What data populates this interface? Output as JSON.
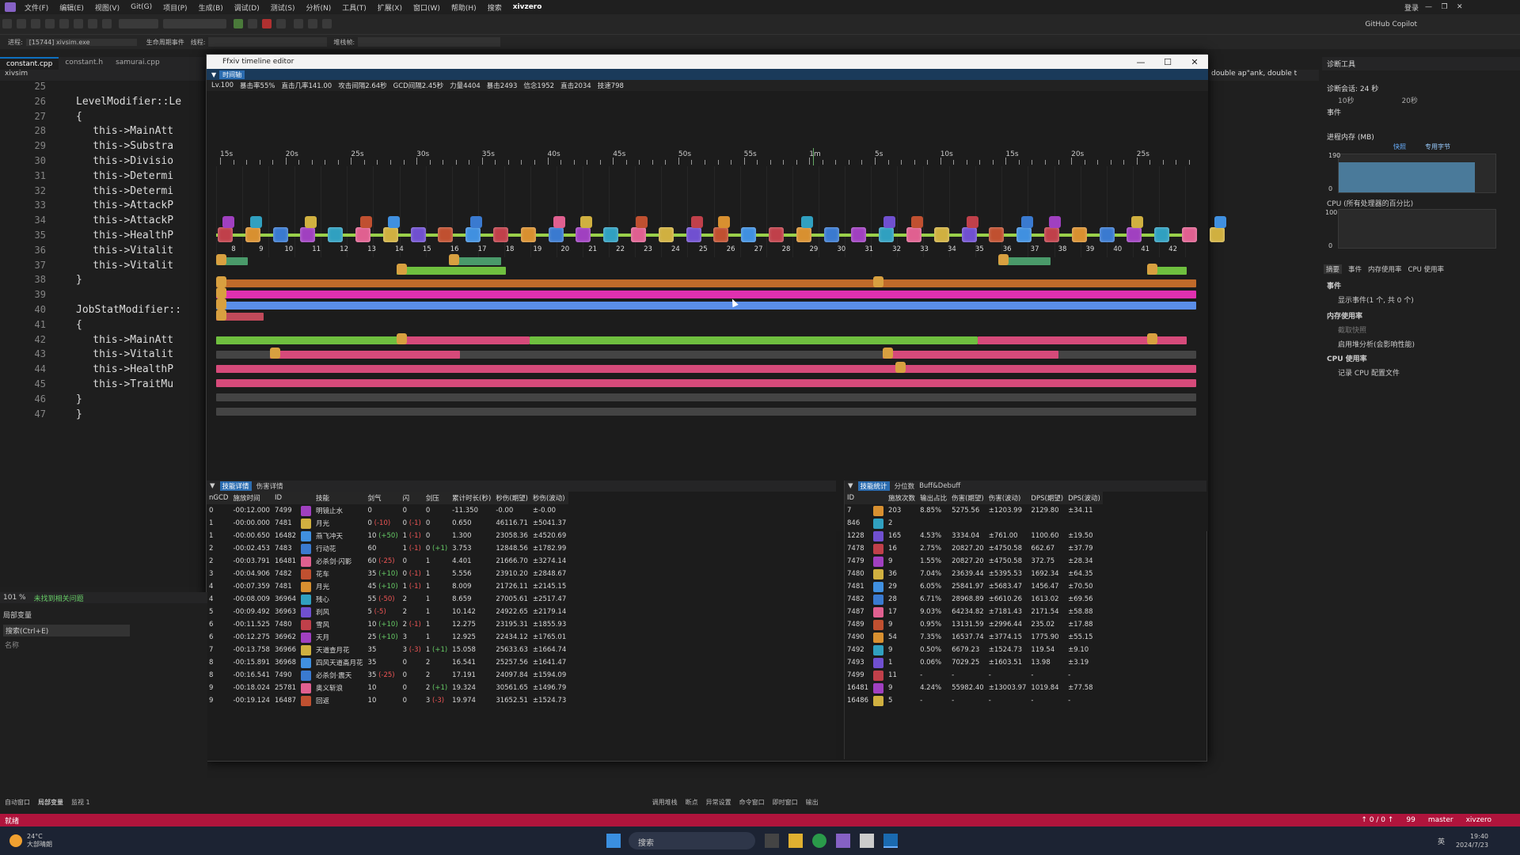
{
  "menu": [
    "文件(F)",
    "编辑(E)",
    "视图(V)",
    "Git(G)",
    "项目(P)",
    "生成(B)",
    "调试(D)",
    "测试(S)",
    "分析(N)",
    "工具(T)",
    "扩展(X)",
    "窗口(W)",
    "帮助(H)",
    "搜索",
    "xivzero"
  ],
  "menu_right": {
    "account": "登录",
    "copilot": "GitHub Copilot"
  },
  "toolbar2": {
    "stack_label": "进程:",
    "stack_value": "[15744] xivsim.exe",
    "lifecycle": "生命周期事件",
    "thread": "线程:",
    "frame": "堆栈帧:"
  },
  "editor_tabs": [
    "constant.cpp",
    "constant.h",
    "samurai.cpp"
  ],
  "editor_scope": "xivsim",
  "code_lines": [
    {
      "n": "25",
      "t": ""
    },
    {
      "n": "26",
      "t": "LevelModifier::Le"
    },
    {
      "n": "27",
      "t": "{"
    },
    {
      "n": "28",
      "t": "    this->MainAtt"
    },
    {
      "n": "29",
      "t": "    this->Substra"
    },
    {
      "n": "30",
      "t": "    this->Divisio"
    },
    {
      "n": "31",
      "t": "    this->Determi"
    },
    {
      "n": "32",
      "t": "    this->Determi"
    },
    {
      "n": "33",
      "t": "    this->AttackP"
    },
    {
      "n": "34",
      "t": "    this->AttackP"
    },
    {
      "n": "35",
      "t": "    this->HealthP"
    },
    {
      "n": "36",
      "t": "    this->Vitalit"
    },
    {
      "n": "37",
      "t": "    this->Vitalit"
    },
    {
      "n": "38",
      "t": "}"
    },
    {
      "n": "39",
      "t": ""
    },
    {
      "n": "40",
      "t": "JobStatModifier::"
    },
    {
      "n": "41",
      "t": "{"
    },
    {
      "n": "42",
      "t": "    this->MainAtt"
    },
    {
      "n": "43",
      "t": "    this->Vitalit"
    },
    {
      "n": "44",
      "t": "    this->HealthP"
    },
    {
      "n": "45",
      "t": "    this->TraitMu"
    },
    {
      "n": "46",
      "t": "}"
    },
    {
      "n": "47",
      "t": "}"
    }
  ],
  "timeline": {
    "title": "Ffxiv timeline editor",
    "tab": "时间轴",
    "stats": [
      "Lv.100",
      "暴击率55%",
      "直击几率141.00",
      "攻击间隔2.64秒",
      "GCD间隔2.45秒",
      "力量4404",
      "暴击2493",
      "信念1952",
      "直击2034",
      "技速798"
    ],
    "time_labels": [
      "15s",
      "20s",
      "25s",
      "30s",
      "35s",
      "40s",
      "45s",
      "50s",
      "55s",
      "1m",
      "5s",
      "10s",
      "15s",
      "20s",
      "25s"
    ],
    "skill_numbers": [
      "8",
      "9",
      "10",
      "11",
      "12",
      "13",
      "14",
      "15",
      "16",
      "17",
      "18",
      "19",
      "20",
      "21",
      "22",
      "23",
      "24",
      "25",
      "26",
      "27",
      "28",
      "29",
      "30",
      "31",
      "32",
      "33",
      "34",
      "35",
      "36",
      "37",
      "38",
      "39",
      "40",
      "41",
      "42"
    ]
  },
  "left_panel": {
    "tabs": [
      "技能详情",
      "伤害详情"
    ],
    "columns": [
      "nGCD",
      "施放时间",
      "ID",
      "",
      "技能",
      "剑气",
      "闪",
      "剑压",
      "累计时长(秒)",
      "秒伤(期望)",
      "秒伤(波动)"
    ],
    "rows": [
      [
        "0",
        "-00:12.000",
        "7499",
        "",
        "明镜止水",
        "0",
        "0",
        "0",
        "-11.350",
        "-0.00",
        "±-0.00"
      ],
      [
        "1",
        "-00:00.000",
        "7481",
        "",
        "月光",
        "0 (-10)",
        "0 (-1)",
        "0",
        "0.650",
        "46116.71",
        "±5041.37"
      ],
      [
        "1",
        "-00:00.650",
        "16482",
        "",
        "燕飞冲天",
        "10 (+50)",
        "1 (-1)",
        "0",
        "1.300",
        "23058.36",
        "±4520.69"
      ],
      [
        "2",
        "-00:02.453",
        "7483",
        "",
        "行动花",
        "60",
        "1 (-1)",
        "0 (+1)",
        "3.753",
        "12848.56",
        "±1782.99"
      ],
      [
        "2",
        "-00:03.791",
        "16481",
        "",
        "必杀剑·闪影",
        "60 (-25)",
        "0",
        "1",
        "4.401",
        "21666.70",
        "±3274.14"
      ],
      [
        "3",
        "-00:04.906",
        "7482",
        "",
        "花车",
        "35 (+10)",
        "0 (-1)",
        "1",
        "5.556",
        "23910.20",
        "±2848.67"
      ],
      [
        "4",
        "-00:07.359",
        "7481",
        "",
        "月光",
        "45 (+10)",
        "1 (-1)",
        "1",
        "8.009",
        "21726.11",
        "±2145.15"
      ],
      [
        "4",
        "-00:08.009",
        "36964",
        "",
        "残心",
        "55 (-50)",
        "2",
        "1",
        "8.659",
        "27005.61",
        "±2517.47"
      ],
      [
        "5",
        "-00:09.492",
        "36963",
        "",
        "刹风",
        "5 (-5)",
        "2",
        "1",
        "10.142",
        "24922.65",
        "±2179.14"
      ],
      [
        "6",
        "-00:11.525",
        "7480",
        "",
        "雪风",
        "10 (+10)",
        "2 (-1)",
        "1",
        "12.275",
        "23195.31",
        "±1855.93"
      ],
      [
        "6",
        "-00:12.275",
        "36962",
        "",
        "天月",
        "25 (+10)",
        "3",
        "1",
        "12.925",
        "22434.12",
        "±1765.01"
      ],
      [
        "7",
        "-00:13.758",
        "36966",
        "",
        "天道查月花",
        "35",
        "3 (-3)",
        "1 (+1)",
        "15.058",
        "25633.63",
        "±1664.74"
      ],
      [
        "8",
        "-00:15.891",
        "36968",
        "",
        "四风天道斋月花",
        "35",
        "0",
        "2",
        "16.541",
        "25257.56",
        "±1641.47"
      ],
      [
        "8",
        "-00:16.541",
        "7490",
        "",
        "必杀剑·震天",
        "35 (-25)",
        "0",
        "2",
        "17.191",
        "24097.84",
        "±1594.09"
      ],
      [
        "9",
        "-00:18.024",
        "25781",
        "",
        "奥义斩浪",
        "10",
        "0",
        "2 (+1)",
        "19.324",
        "30561.65",
        "±1496.79"
      ],
      [
        "9",
        "-00:19.124",
        "16487",
        "",
        "回返",
        "10",
        "0",
        "3 (-3)",
        "19.974",
        "31652.51",
        "±1524.73"
      ]
    ]
  },
  "right_panel": {
    "tabs": [
      "技能统计",
      "分位数",
      "Buff&Debuff"
    ],
    "columns": [
      "ID",
      "",
      "施放次数",
      "输出占比",
      "伤害(期望)",
      "伤害(波动)",
      "DPS(期望)",
      "DPS(波动)"
    ],
    "rows": [
      [
        "7",
        "",
        "203",
        "8.85%",
        "5275.56",
        "±1203.99",
        "2129.80",
        "±34.11"
      ],
      [
        "846",
        "",
        "2",
        "",
        "",
        "",
        "",
        ""
      ],
      [
        "1228",
        "",
        "165",
        "4.53%",
        "3334.04",
        "±761.00",
        "1100.60",
        "±19.50"
      ],
      [
        "7478",
        "",
        "16",
        "2.75%",
        "20827.20",
        "±4750.58",
        "662.67",
        "±37.79"
      ],
      [
        "7479",
        "",
        "9",
        "1.55%",
        "20827.20",
        "±4750.58",
        "372.75",
        "±28.34"
      ],
      [
        "7480",
        "",
        "36",
        "7.04%",
        "23639.44",
        "±5395.53",
        "1692.34",
        "±64.35"
      ],
      [
        "7481",
        "",
        "29",
        "6.05%",
        "25841.97",
        "±5683.47",
        "1456.47",
        "±70.50"
      ],
      [
        "7482",
        "",
        "28",
        "6.71%",
        "28968.89",
        "±6610.26",
        "1613.02",
        "±69.56"
      ],
      [
        "7487",
        "",
        "17",
        "9.03%",
        "64234.82",
        "±7181.43",
        "2171.54",
        "±58.88"
      ],
      [
        "7489",
        "",
        "9",
        "0.95%",
        "13131.59",
        "±2996.44",
        "235.02",
        "±17.88"
      ],
      [
        "7490",
        "",
        "54",
        "7.35%",
        "16537.74",
        "±3774.15",
        "1775.90",
        "±55.15"
      ],
      [
        "7492",
        "",
        "9",
        "0.50%",
        "6679.23",
        "±1524.73",
        "119.54",
        "±9.10"
      ],
      [
        "7493",
        "",
        "1",
        "0.06%",
        "7029.25",
        "±1603.51",
        "13.98",
        "±3.19"
      ],
      [
        "7499",
        "",
        "11",
        "-",
        "-",
        "-",
        "-",
        "-"
      ],
      [
        "16481",
        "",
        "9",
        "4.24%",
        "55982.40",
        "±13003.97",
        "1019.84",
        "±77.58"
      ],
      [
        "16486",
        "",
        "5",
        "-",
        "-",
        "-",
        "-",
        "-"
      ]
    ]
  },
  "diag": {
    "title": "诊断工具",
    "session": "诊断会话: 24 秒",
    "scale": [
      "10秒",
      "20秒"
    ],
    "events": "事件",
    "mem_title": "进程内存 (MB)",
    "mem_legend": [
      "快照",
      "专用字节"
    ],
    "mem_scale": [
      "190",
      "0"
    ],
    "cpu_title": "CPU (所有处理器的百分比)",
    "cpu_scale": [
      "100",
      "0"
    ],
    "tabs": [
      "摘要",
      "事件",
      "内存使用率",
      "CPU 使用率"
    ],
    "events_head": "事件",
    "events_line": "显示事件(1 个, 共 0 个)",
    "mem_head": "内存使用率",
    "mem_snap": "截取快照",
    "mem_heap": "启用堆分析(会影响性能)",
    "cpu_head": "CPU 使用率",
    "cpu_rec": "记录 CPU 配置文件"
  },
  "right_code": "double ap\"ank, double t",
  "output": {
    "title": "局部变量",
    "search": "搜索(Ctrl+E)",
    "col": "名称",
    "zoom": "101 %",
    "issues": "未找到相关问题"
  },
  "bottom_tabs": [
    "自动窗口",
    "局部变量",
    "监视 1"
  ],
  "bottom_tabs_mid": [
    "调用堆栈",
    "断点",
    "异常设置",
    "命令窗口",
    "即时窗口",
    "输出"
  ],
  "status": {
    "left": "就绪",
    "lines": "↑ 0 / 0 ↑",
    "pencil": "99",
    "branch": "master",
    "repo": "xivzero"
  },
  "taskbar": {
    "weather": "24°C",
    "weather2": "大部晴朗",
    "search": "搜索",
    "time": "19:40",
    "date": "2024/7/23",
    "lang": "英"
  },
  "colors": {
    "status_red": "#b0143c",
    "accent": "#2b6cb0",
    "green_bar": "#6fbf3f",
    "pink_bar": "#d64a7a",
    "orange_bar": "#d06a2a",
    "blue_bar": "#5a8ee8",
    "magenta_bar": "#e030b0"
  }
}
